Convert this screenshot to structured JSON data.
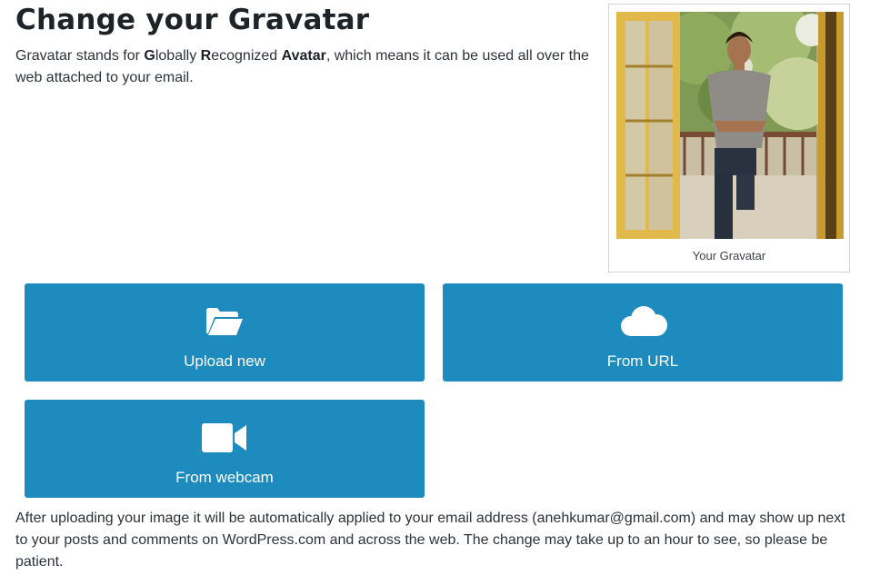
{
  "header": {
    "title": "Change your Gravatar"
  },
  "intro": {
    "part1": "Gravatar stands for ",
    "g": "G",
    "part2": "lobally ",
    "r": "R",
    "part3": "ecognized ",
    "avatar": "Avatar",
    "part4": ", which means it can be used all over the web attached to your email."
  },
  "gravatar": {
    "caption": "Your Gravatar"
  },
  "actions": {
    "upload_label": "Upload new",
    "upload_icon": "folder-open-icon",
    "url_label": "From URL",
    "url_icon": "cloud-icon",
    "webcam_label": "From webcam",
    "webcam_icon": "video-camera-icon"
  },
  "footer": {
    "note": "After uploading your image it will be automatically applied to your email address (anehkumar@gmail.com) and may show up next to your posts and comments on WordPress.com and across the web. The change may take up to an hour to see, so please be patient."
  },
  "colors": {
    "button_bg": "#1e8bbf",
    "button_text": "#ffffff",
    "title_text": "#1d2327",
    "body_text": "#2c3338"
  }
}
